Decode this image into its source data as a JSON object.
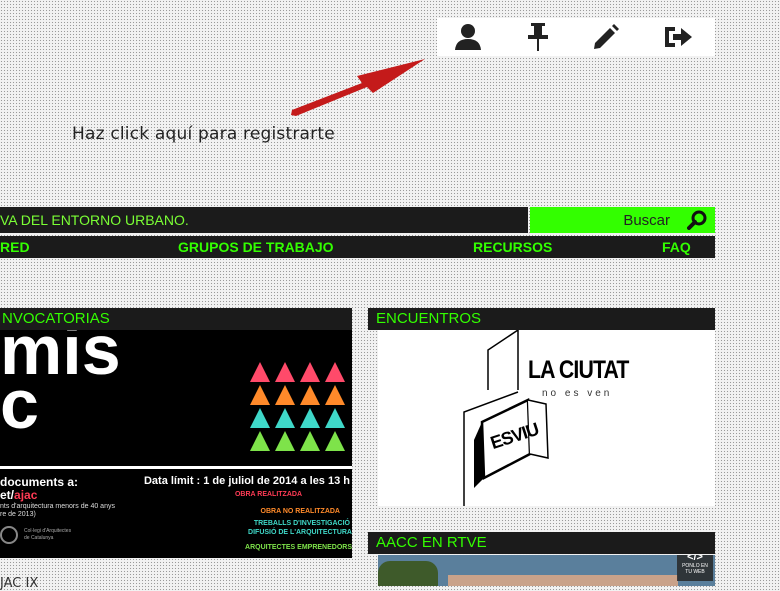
{
  "toolbar": {
    "icons": [
      "user-icon",
      "pushpin-icon",
      "pencil-icon",
      "sign-out-icon"
    ]
  },
  "hint": {
    "text": "Haz click aquí para registrarte"
  },
  "header": {
    "tagline": "VA DEL ENTORNO URBANO.",
    "search_label": "Buscar"
  },
  "nav": {
    "items": [
      "RED",
      "GRUPOS DE TRABAJO",
      "RECURSOS",
      "FAQ"
    ]
  },
  "convocatorias": {
    "title": "NVOCATORIAS",
    "poster": {
      "big_line1": "mis",
      "big_line2": "c",
      "docs_label": "documents a:",
      "site_prefix": "et/",
      "site_highlight": "ajac",
      "small1": "nts d'arquitectura menors de 40 anys",
      "small2": "re de 2013)",
      "deadline": "Data límit : 1 de juliol de 2014 a les 13 h",
      "cat1": "OBRA REALITZADA",
      "cat2": "OBRA NO REALITZADA",
      "cat3a": "TREBALLS D'INVESTIGACIÓ",
      "cat3b": "DIFUSIÓ DE L'ARQUITECTURA",
      "cat4": "ARQUITECTES EMPRENEDORS",
      "org1": "Col·legi d'Arquitectes",
      "org2": "de Catalunya"
    },
    "caption": "JAC IX"
  },
  "encuentros": {
    "title": "ENCUENTROS",
    "logo_title": "LA CIUTAT",
    "logo_sub": "no es ven",
    "sign_text": "ESVIU"
  },
  "rtve": {
    "title": "AACC EN RTVE",
    "embed_icon": "</>",
    "embed_label1": "PONLO EN",
    "embed_label2": "TU WEB"
  },
  "colors": {
    "accent": "#33ff00",
    "dark": "#1b1b1b",
    "arrow": "#c41a1a"
  }
}
